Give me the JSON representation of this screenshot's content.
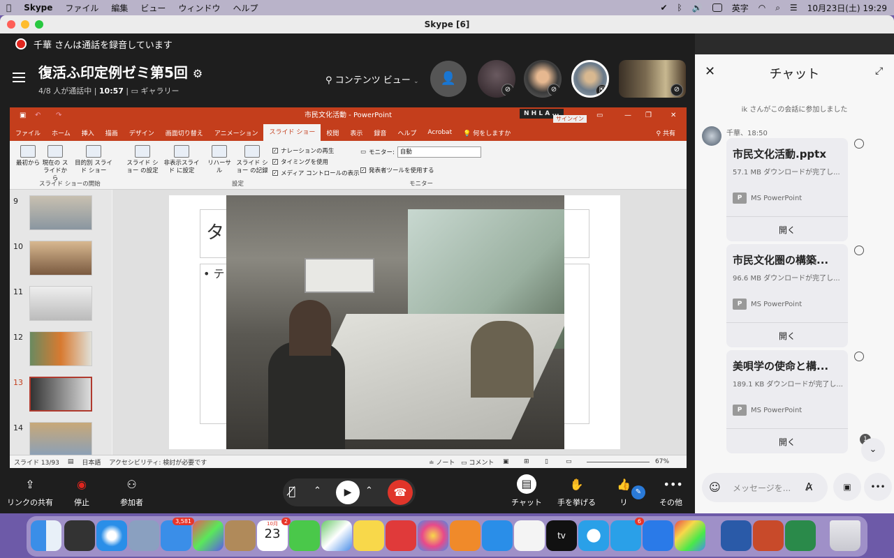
{
  "menubar": {
    "app": "Skype",
    "items": [
      "ファイル",
      "編集",
      "ビュー",
      "ウィンドウ",
      "ヘルプ"
    ],
    "input_mode": "英字",
    "clock": "10月23日(土) 19:29"
  },
  "window": {
    "title": "Skype [6]"
  },
  "recording": {
    "text": "千華 さんは通話を録音しています"
  },
  "meeting": {
    "title": "復活ふ印定例ゼミ第5回",
    "status_count": "4/8 人が通話中",
    "duration": "10:57",
    "view_mode": "ギャラリー",
    "content_view": "コンテンツ ビュー"
  },
  "powerpoint": {
    "title": "市民文化活動 - PowerPoint",
    "signin_overlay": "N H L A ...",
    "signin": "サインイン",
    "tabs": [
      "ファイル",
      "ホーム",
      "挿入",
      "描画",
      "デザイン",
      "画面切り替え",
      "アニメーション",
      "スライド ショー",
      "校閲",
      "表示",
      "録音",
      "ヘルプ",
      "Acrobat",
      "何をしますか"
    ],
    "share": "共有",
    "ribbon": {
      "from_start": "最初から",
      "from_current": "現在の スライドから",
      "custom": "目的別 スライド ショー",
      "group_start": "スライド ショーの開始",
      "setup": "スライド ショー の設定",
      "hide": "非表示スライド に設定",
      "rehearse": "リハーサル",
      "record": "スライド ショー の記録",
      "chk_narration": "ナレーションの再生",
      "chk_timing": "タイミングを使用",
      "chk_media": "メディア コントロールの表示",
      "group_setup": "設定",
      "monitor_label": "モニター:",
      "monitor_value": "自動",
      "chk_presenter": "発表者ツールを使用する",
      "group_monitor": "モニター"
    },
    "thumbs": [
      "9",
      "10",
      "11",
      "12",
      "13",
      "14"
    ],
    "slide_title_fragment": "タ",
    "slide_bullet_fragment": "• テ",
    "status": {
      "slide": "スライド 13/93",
      "lang": "日本語",
      "accessibility": "アクセシビリティ: 検討が必要です",
      "notes": "ノート",
      "comments": "コメント",
      "zoom": "67%"
    }
  },
  "controls": {
    "share_link": "リンクの共有",
    "stop": "停止",
    "participants": "参加者",
    "chat": "チャット",
    "raise_hand": "手を挙げる",
    "react": "リ",
    "more": "その他"
  },
  "chat": {
    "title": "チャット",
    "system_msg": "ik さんがこの会話に参加しました",
    "sender": "千華、18:50",
    "files": [
      {
        "name": "市民文化活動.pptx",
        "size": "57.1 MB ダウンロードが完了し...",
        "app": "MS PowerPoint",
        "open": "開く"
      },
      {
        "name": "市民文化圏の構築...",
        "size": "96.6 MB ダウンロードが完了し...",
        "app": "MS PowerPoint",
        "open": "開く"
      },
      {
        "name": "美唄学の使命と構...",
        "size": "189.1 KB ダウンロードが完了し...",
        "app": "MS PowerPoint",
        "open": "開く"
      }
    ],
    "unread": "1",
    "placeholder": "メッセージを..."
  },
  "dock": {
    "mail_badge": "3,581",
    "cal_month": "10月",
    "cal_day": "23",
    "cal_badge": "2",
    "skype_badge": "6",
    "tv": "tv"
  }
}
